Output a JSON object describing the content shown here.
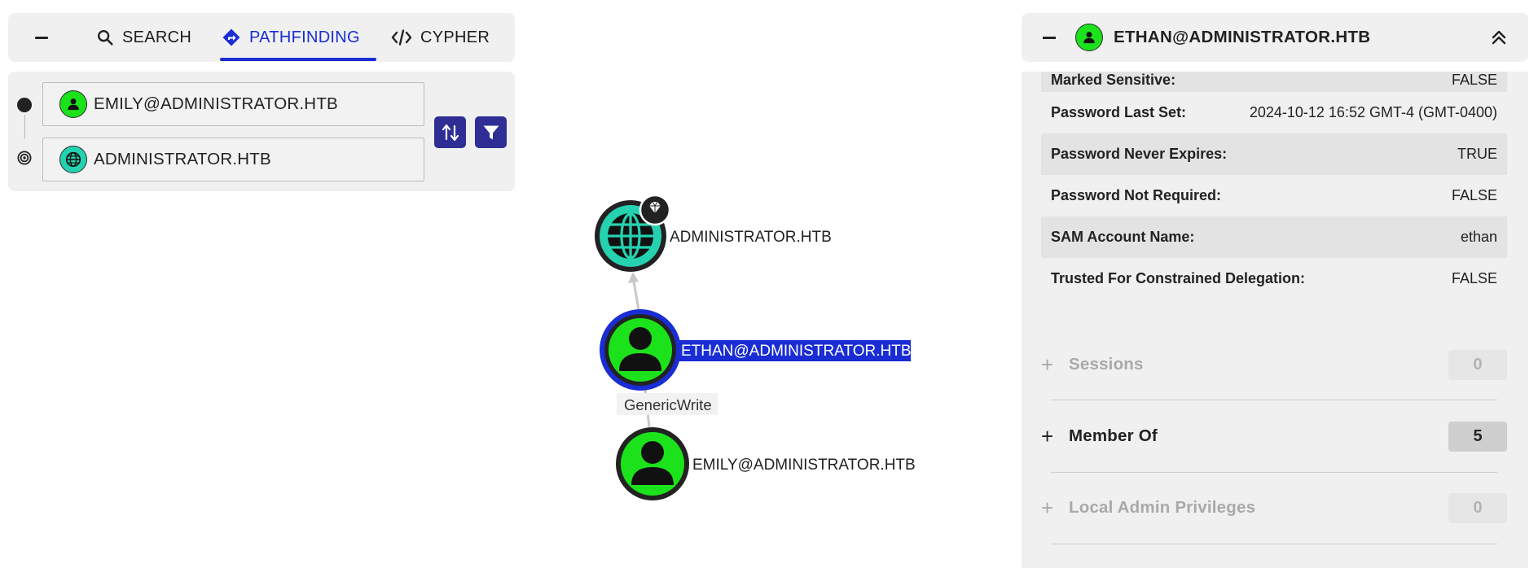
{
  "tabs": {
    "search_label": "SEARCH",
    "pathfinding_label": "PATHFINDING",
    "cypher_label": "CYPHER",
    "active": "PATHFINDING",
    "accent_color": "#1a2cd4"
  },
  "pathfinding": {
    "start_node": "EMILY@ADMINISTRATOR.HTB",
    "end_node": "ADMINISTRATOR.HTB",
    "swap_icon": "swap-vertical-icon",
    "filter_icon": "filter-icon"
  },
  "graph": {
    "nodes": {
      "domain": {
        "label": "ADMINISTRATOR.HTB",
        "type": "Domain",
        "badge": "tier-zero-gem-icon",
        "color": "#24d2b0"
      },
      "ethan": {
        "label": "ETHAN@ADMINISTRATOR.HTB",
        "type": "User",
        "selected": true,
        "color": "#1be21b",
        "highlight_color": "#1a2cd4"
      },
      "emily": {
        "label": "EMILY@ADMINISTRATOR.HTB",
        "type": "User",
        "color": "#1be21b"
      }
    },
    "edges": {
      "ethan_to_domain": {
        "label": ""
      },
      "emily_to_ethan": {
        "label": "GenericWrite"
      }
    }
  },
  "details": {
    "title": "ETHAN@ADMINISTRATOR.HTB",
    "properties": [
      {
        "key": "Marked Sensitive:",
        "value": "FALSE"
      },
      {
        "key": "Password Last Set:",
        "value": "2024-10-12 16:52 GMT-4 (GMT-0400)"
      },
      {
        "key": "Password Never Expires:",
        "value": "TRUE"
      },
      {
        "key": "Password Not Required:",
        "value": "FALSE"
      },
      {
        "key": "SAM Account Name:",
        "value": "ethan"
      },
      {
        "key": "Trusted For Constrained Delegation:",
        "value": "FALSE"
      }
    ],
    "sections": [
      {
        "label": "Sessions",
        "count": "0",
        "enabled": false
      },
      {
        "label": "Member Of",
        "count": "5",
        "enabled": true
      },
      {
        "label": "Local Admin Privileges",
        "count": "0",
        "enabled": false
      }
    ]
  }
}
